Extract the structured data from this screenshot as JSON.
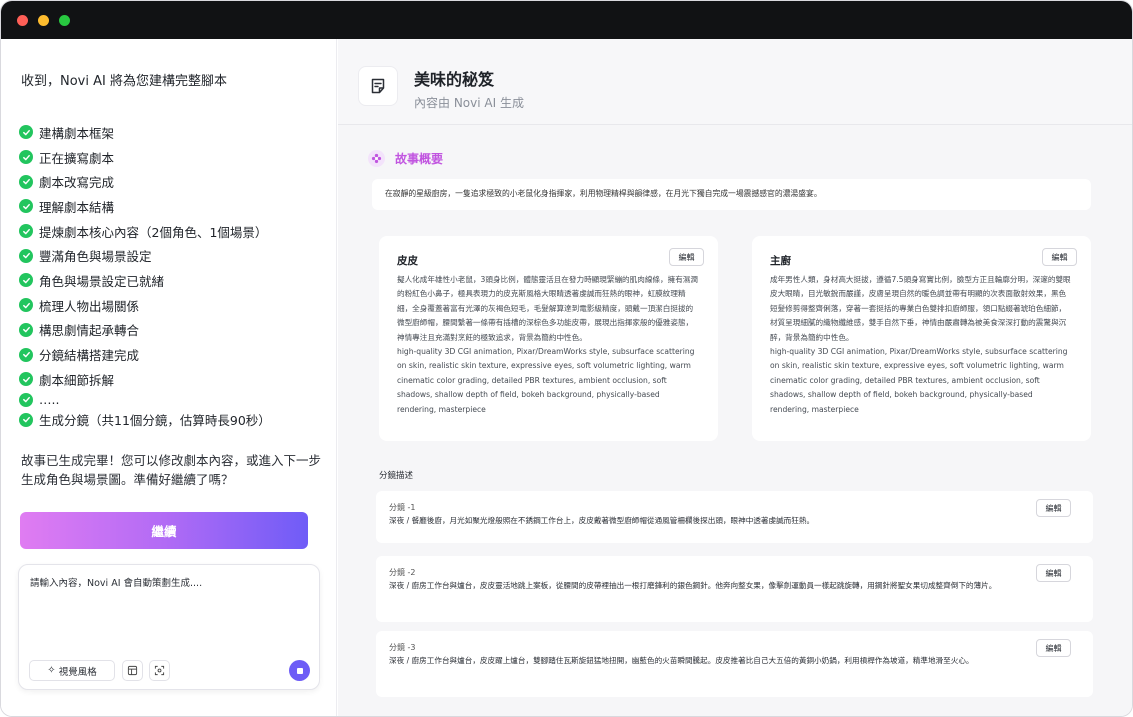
{
  "left": {
    "intro": "收到，Novi AI 將為您建構完整腳本",
    "steps": [
      "建構劇本框架",
      "正在擴寫劇本",
      "劇本改寫完成",
      "理解劇本結構",
      "提煉劇本核心內容（2個角色、1個場景）",
      "豐滿角色與場景設定",
      "角色與場景設定已就緒",
      "梳理人物出場關係",
      "構思劇情起承轉合",
      "分鏡結構搭建完成",
      "劇本細節拆解",
      "…..",
      "生成分鏡（共11個分鏡，估算時長90秒）"
    ],
    "done_message": "故事已生成完畢！您可以修改劇本內容，或進入下一步生成角色與場景圖。準備好繼續了嗎？",
    "continue_label": "繼續",
    "composer": {
      "placeholder": "請輸入內容，Novi AI 會自動策劃生成....",
      "style_label": "視覺風格"
    }
  },
  "document": {
    "title": "美味的秘笈",
    "subtitle": "內容由 Novi AI 生成",
    "story_section": "故事概要",
    "summary": "在寂靜的星級廚房，一隻追求極致的小老鼠化身指揮家，利用物理精桿與韻律感，在月光下獨自完成一場震撼感官的濃湯盛宴。",
    "edit_label": "編輯",
    "characters": [
      {
        "name": "皮皮",
        "desc": "擬人化成年雄性小老鼠，3頭身比例，體態靈活且在發力時顯現緊繃的肌肉線條，擁有濕潤的粉紅色小鼻子，極具表現力的皮克斯風格大眼睛透著虔誠而狂熱的眼神，虹膜紋理精細，全身覆蓋著富有光澤的灰褐色短毛，毛髮解算達到電影級精度，頭戴一頂潔白挺拔的微型廚師帽，腰間繫著一條帶有插槽的深棕色多功能皮帶，展現出指揮家般的優雅姿態，神情專注且充滿對烹飪的極致追求，背景為簡約中性色。",
        "prompt": "high-quality 3D CGI animation, Pixar/DreamWorks style, subsurface scattering on skin, realistic skin texture, expressive eyes, soft volumetric lighting, warm cinematic color grading, detailed PBR textures, ambient occlusion, soft shadows, shallow depth of field, bokeh background, physically-based rendering, masterpiece"
      },
      {
        "name": "主廚",
        "desc": "成年男性人類，身材高大挺拔，遵循7.5頭身寫實比例，臉型方正且輪廓分明，深邃的雙眼皮大眼睛，目光敏銳而嚴謹，皮膚呈現自然的暖色調並帶有明顯的次表面散射效果，黑色短髮修剪得整齊俐落，穿著一套挺括的專業白色雙排扣廚師服，領口點綴著琥珀色細節，材質呈現細膩的織物纖維感，雙手自然下垂，神情由嚴肅轉為被美食深深打動的震驚與沉醉，背景為簡約中性色。",
        "prompt": "high-quality 3D CGI animation, Pixar/DreamWorks style, subsurface scattering on skin, realistic skin texture, expressive eyes, soft volumetric lighting, warm cinematic color grading, detailed PBR textures, ambient occlusion, soft shadows, shallow depth of field, bokeh background, physically-based rendering, masterpiece"
      }
    ],
    "shots_label": "分鏡描述",
    "shots": [
      {
        "label": "分鏡 -1",
        "text": "深夜 / 餐廳後廚，月光如聚光燈般照在不銹鋼工作台上，皮皮戴著微型廚師帽從通風管柵欄後探出頭，眼神中透著虔誠而狂熱。"
      },
      {
        "label": "分鏡 -2",
        "text": "深夜 / 廚房工作台與爐台，皮皮靈活地跳上案板，從腰間的皮帶裡抽出一根打磨鋒利的銀色鋼針。他奔向整女果，像擊劍運動員一樣起跳旋轉，用鋼針將聖女果切成整齊倒下的薄片。"
      },
      {
        "label": "分鏡 -3",
        "text": "深夜 / 廚房工作台與爐台，皮皮躍上爐台，雙腳踏住瓦斯旋鈕猛地扭開，幽藍色的火苗瞬間騰起。皮皮推著比自己大五倍的黃銅小奶鍋，利用槓桿作為坡道，精準地滑至火心。"
      }
    ]
  },
  "colors": {
    "accent_purple": "#6d5cf6",
    "accent_pink": "#c155e0",
    "check_green": "#22c55e"
  }
}
